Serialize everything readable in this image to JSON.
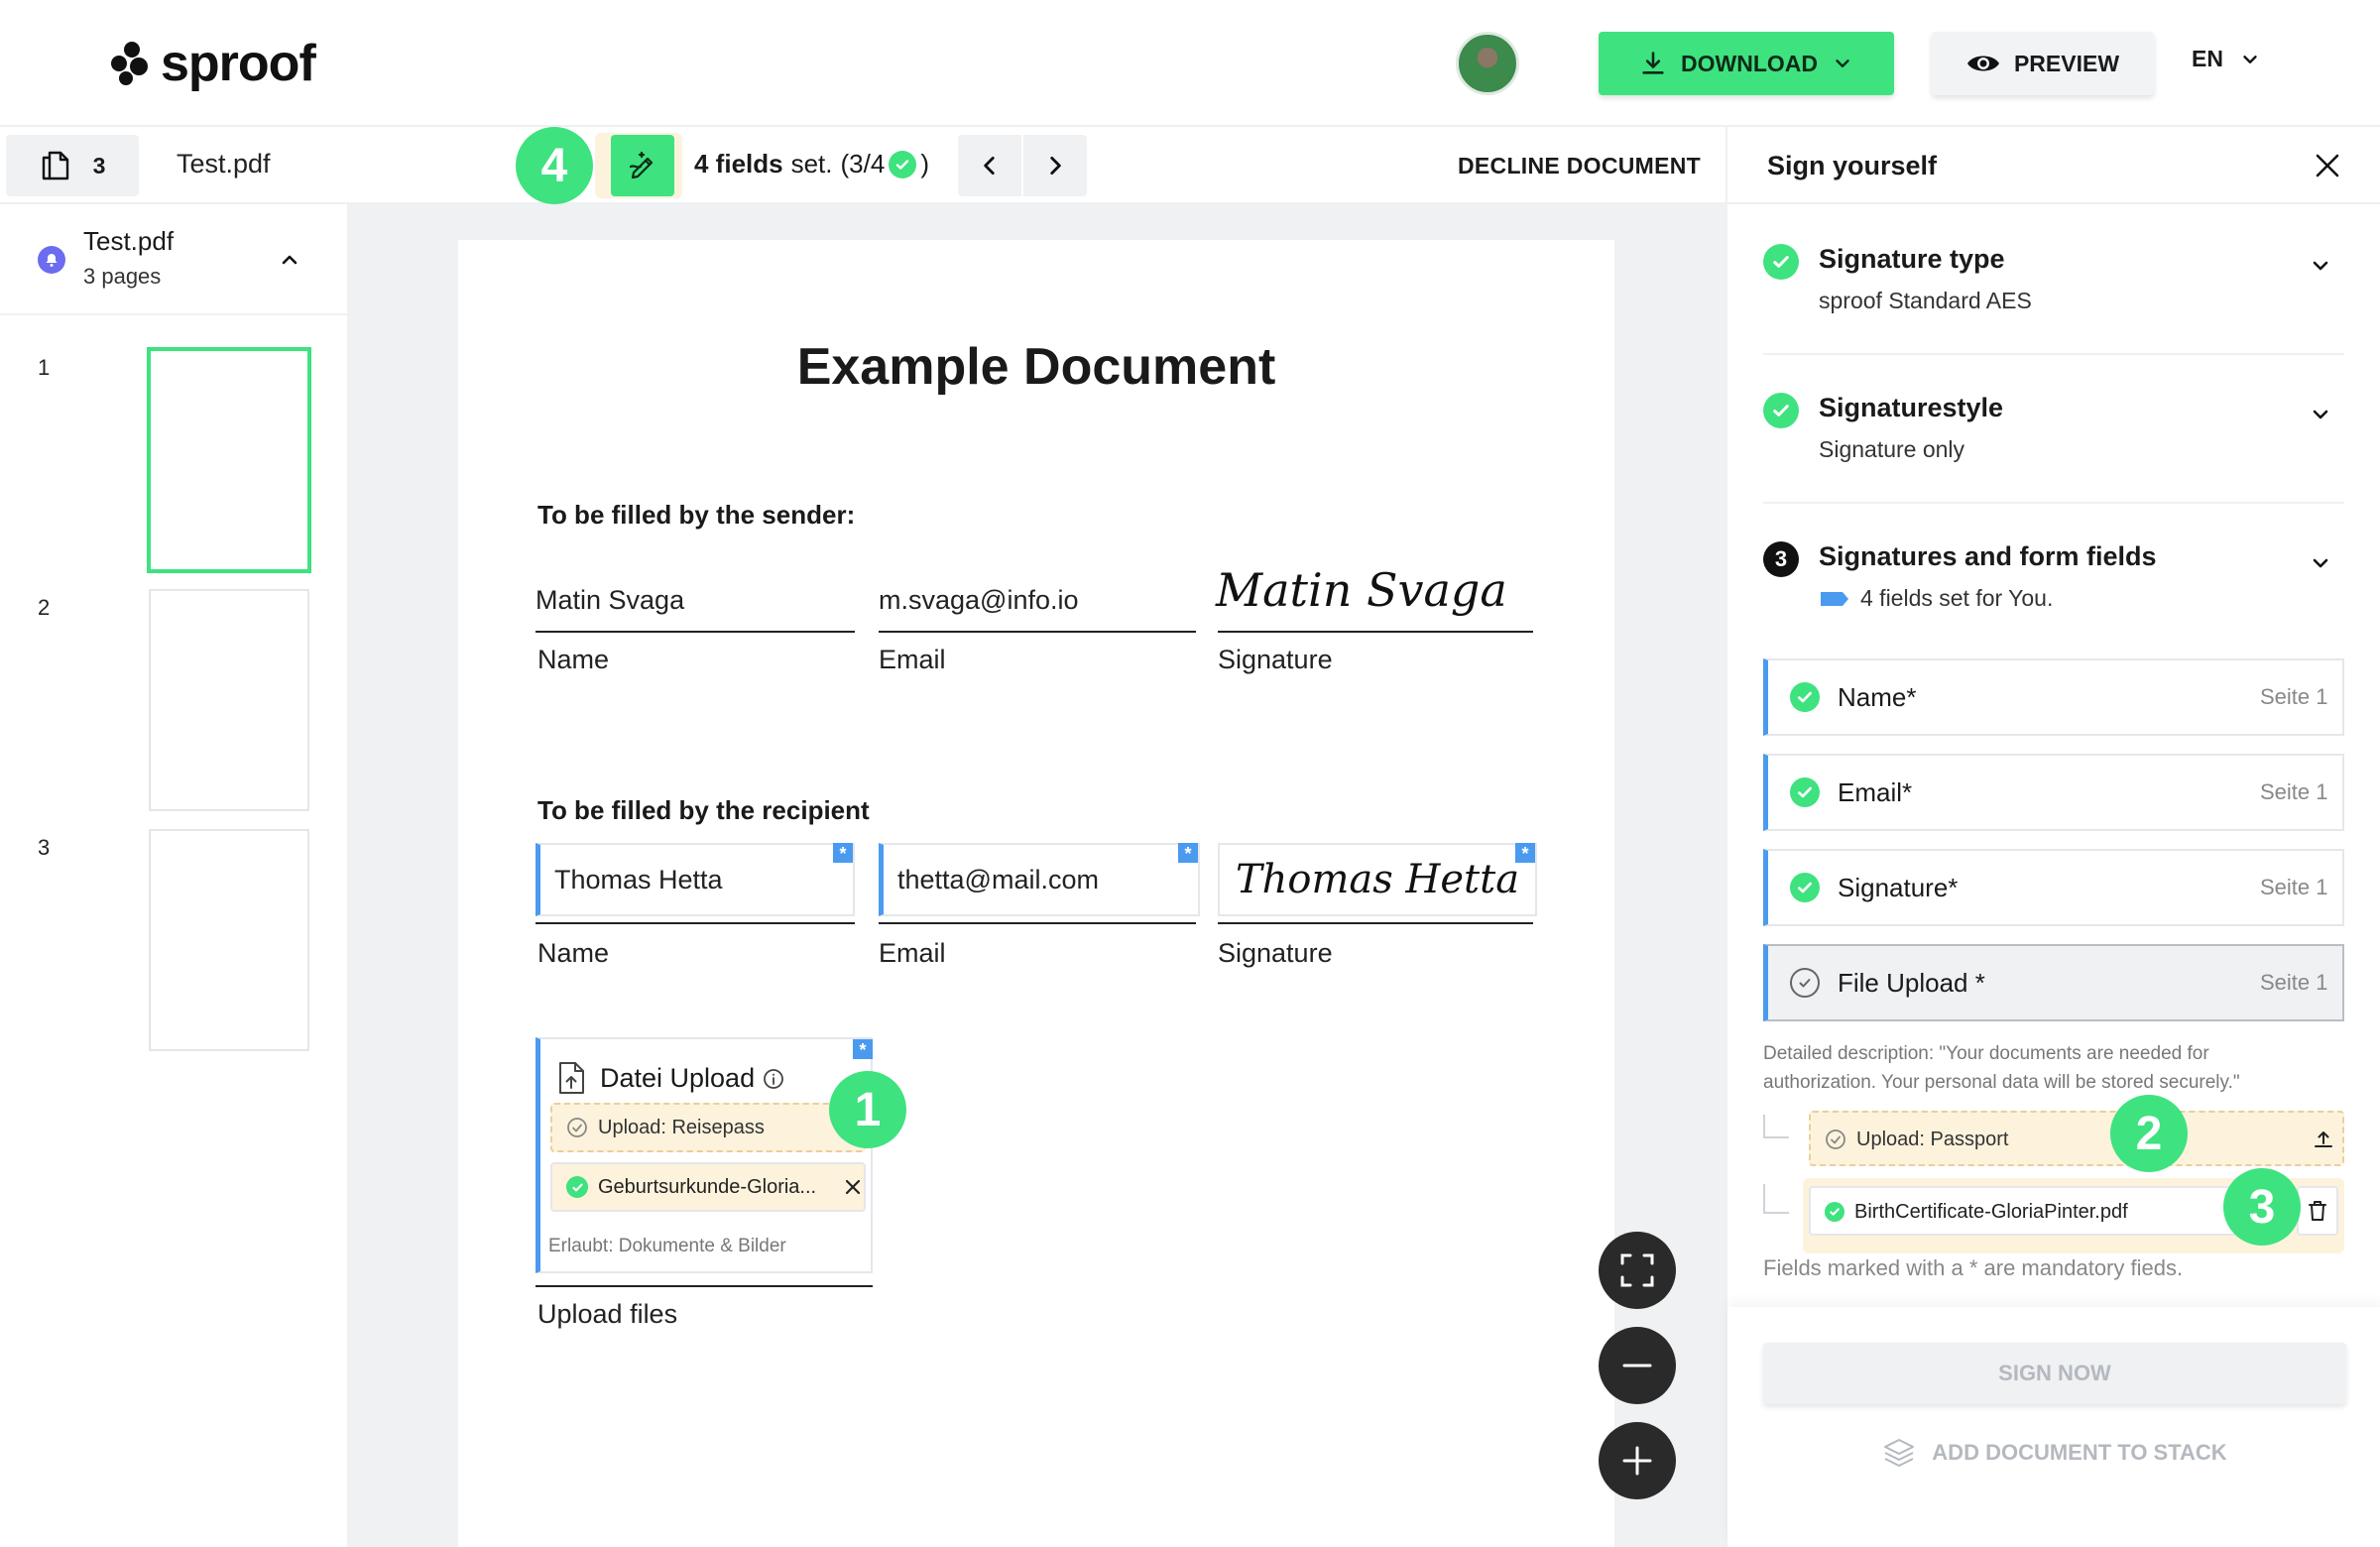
{
  "header": {
    "logo_text": "sproof",
    "download_label": "DOWNLOAD",
    "preview_label": "PREVIEW",
    "language": "EN"
  },
  "toolbar": {
    "document_count": "3",
    "document_name": "Test.pdf",
    "fields_count": "4 fields",
    "fields_set": "set.",
    "fields_progress": "(3/4",
    "fields_close": ")",
    "decline_label": "DECLINE DOCUMENT"
  },
  "sidebar": {
    "document_name": "Test.pdf",
    "document_pages": "3 pages",
    "thumbnails": [
      {
        "number": "1",
        "active": true
      },
      {
        "number": "2",
        "active": false
      },
      {
        "number": "3",
        "active": false
      }
    ]
  },
  "document": {
    "title": "Example Document",
    "sender_section": "To be filled by the sender:",
    "sender_name": "Matin Svaga",
    "sender_email": "m.svaga@info.io",
    "sender_signature": "Matin Svaga",
    "recipient_section": "To be filled by the recipient",
    "recipient_name": "Thomas Hetta",
    "recipient_email": "thetta@mail.com",
    "recipient_signature": "Thomas Hetta",
    "label_name": "Name",
    "label_email": "Email",
    "label_signature": "Signature",
    "required_mark": "*",
    "upload": {
      "title": "Datei Upload",
      "requirement": "Upload: Reisepass",
      "file": "Geburtsurkunde-Gloria...",
      "allowed": "Erlaubt: Dokumente & Bilder",
      "label": "Upload files"
    }
  },
  "badges": [
    "1",
    "2",
    "3",
    "4"
  ],
  "panel": {
    "title": "Sign yourself",
    "steps": [
      {
        "title": "Signature type",
        "subtitle": "sproof Standard AES",
        "status": "done"
      },
      {
        "title": "Signaturestyle",
        "subtitle": "Signature only",
        "status": "done"
      },
      {
        "number": "3",
        "title": "Signatures and form fields",
        "subtitle": "4 fields set for You.",
        "status": "active"
      }
    ],
    "fields": [
      {
        "label": "Name*",
        "page": "Seite 1",
        "done": true
      },
      {
        "label": "Email*",
        "page": "Seite 1",
        "done": true
      },
      {
        "label": "Signature*",
        "page": "Seite 1",
        "done": true
      },
      {
        "label": "File Upload *",
        "page": "Seite 1",
        "done": false
      }
    ],
    "description": "Detailed description: \"Your documents are needed for authorization. Your personal data will be stored securely.\"",
    "upload_requirement": "Upload: Passport",
    "uploaded_file": "BirthCertificate-GloriaPinter.pdf",
    "mandatory_note": "Fields marked with a * are mandatory fieds.",
    "sign_now": "SIGN NOW",
    "add_to_stack": "ADD DOCUMENT TO STACK"
  },
  "colors": {
    "accent_green": "#3ee27f",
    "field_blue": "#4a9af0",
    "highlight_yellow": "#fdf3dc"
  }
}
